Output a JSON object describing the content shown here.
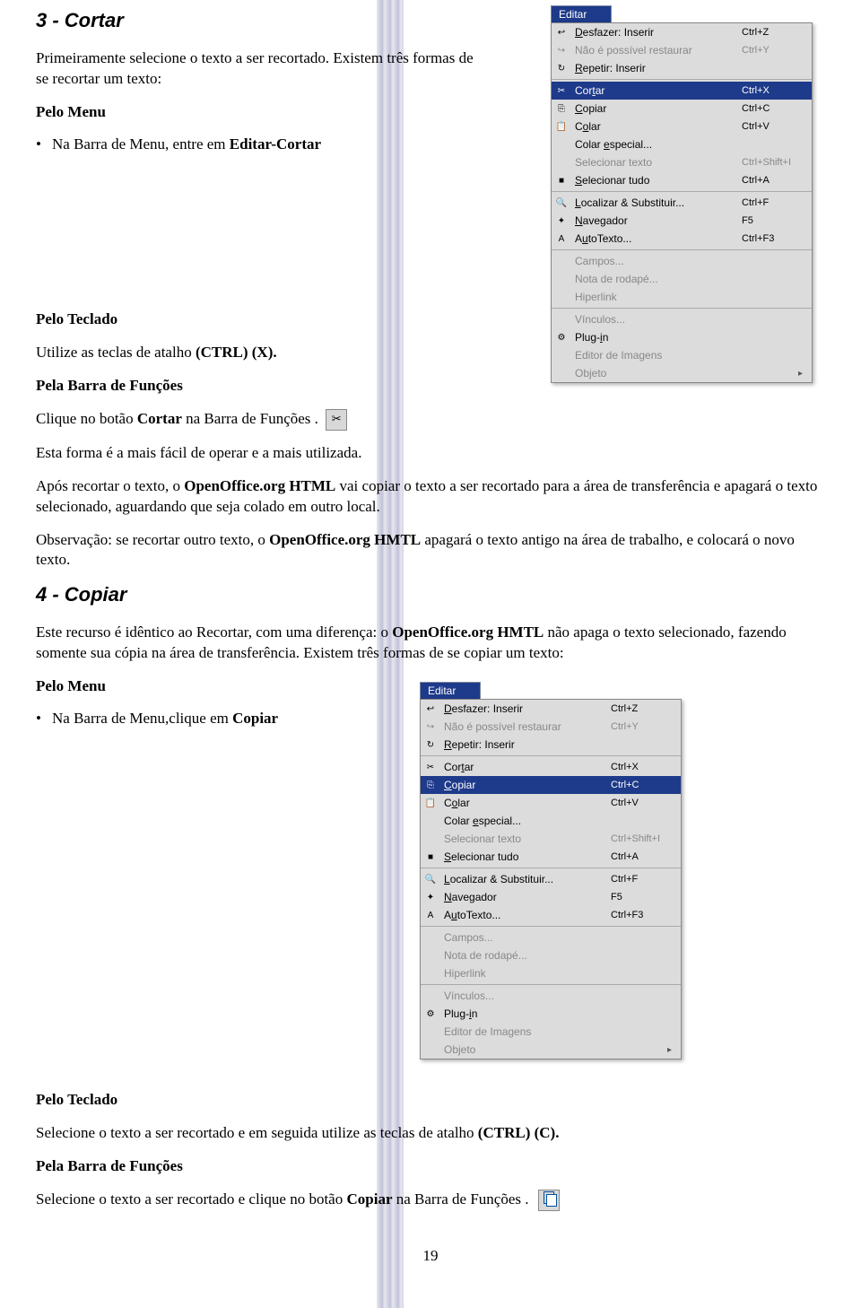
{
  "section3": {
    "title": "3 - Cortar",
    "p1": "Primeiramente selecione o texto a ser recortado. Existem três formas de se recortar um texto:",
    "pelo_menu": "Pelo Menu",
    "bullet1_pre": "Na Barra de Menu, entre em ",
    "bullet1_bold": "Editar-Cortar",
    "pelo_teclado": "Pelo Teclado",
    "p2_pre": "Utilize as teclas de atalho ",
    "p2_bold": "(CTRL) (X).",
    "pela_barra": "Pela Barra de Funções",
    "p3_pre": "Clique no botão ",
    "p3_bold": "Cortar",
    "p3_post": " na  Barra de Funções .",
    "p4": "Esta forma é a mais fácil de operar e a mais utilizada.",
    "p5_pre": "Após recortar o texto, o ",
    "p5_bold": "OpenOffice.org HTML",
    "p5_post": " vai copiar o texto a ser recortado para a área de transferência e apagará o texto selecionado, aguardando que seja colado em outro local.",
    "p6_pre": "Observação: se recortar outro texto, o ",
    "p6_bold": "OpenOffice.org HMTL",
    "p6_post": " apagará o texto antigo na área de trabalho, e colocará o novo texto."
  },
  "section4": {
    "title": "4 - Copiar",
    "p1_pre": "Este recurso é idêntico ao Recortar, com uma diferença: o ",
    "p1_bold": "OpenOffice.org HMTL",
    "p1_post": " não apaga o texto selecionado, fazendo somente sua cópia na área de transferência. Existem três formas de se copiar um texto:",
    "pelo_menu": "Pelo Menu",
    "bullet1_pre": "Na Barra de Menu,clique em ",
    "bullet1_bold": "Copiar",
    "pelo_teclado": "Pelo Teclado",
    "p2_pre": "Selecione o texto a ser recortado e em seguida utilize as teclas de atalho ",
    "p2_bold": "(CTRL) (C).",
    "pela_barra": "Pela Barra de Funções",
    "p3_pre": "Selecione o texto a ser recortado e clique no botão ",
    "p3_bold": "Copiar",
    "p3_post": " na  Barra de Funções ."
  },
  "menu": {
    "title": "Editar",
    "groups": [
      [
        {
          "icon": "↩",
          "label": "Desfazer: Inserir",
          "short": "Ctrl+Z",
          "disabled": false,
          "ul": "D"
        },
        {
          "icon": "↪",
          "label": "Não é possível restaurar",
          "short": "Ctrl+Y",
          "disabled": true
        },
        {
          "icon": "↻",
          "label": "Repetir: Inserir",
          "short": "",
          "disabled": false,
          "ul": "R"
        }
      ],
      [
        {
          "icon": "✂",
          "label": "Cortar",
          "short": "Ctrl+X",
          "selected": true,
          "ul": "t"
        },
        {
          "icon": "⎘",
          "label": "Copiar",
          "short": "Ctrl+C",
          "ul": "C"
        },
        {
          "icon": "📋",
          "label": "Colar",
          "short": "Ctrl+V",
          "ul": "o"
        },
        {
          "icon": "",
          "label": "Colar especial...",
          "short": "",
          "ul": "e"
        },
        {
          "icon": "",
          "label": "Selecionar texto",
          "short": "Ctrl+Shift+I",
          "disabled": true
        },
        {
          "icon": "■",
          "label": "Selecionar tudo",
          "short": "Ctrl+A",
          "ul": "S"
        }
      ],
      [
        {
          "icon": "🔍",
          "label": "Localizar & Substituir...",
          "short": "Ctrl+F",
          "ul": "L"
        },
        {
          "icon": "✦",
          "label": "Navegador",
          "short": "F5",
          "ul": "N"
        },
        {
          "icon": "A",
          "label": "AutoTexto...",
          "short": "Ctrl+F3",
          "ul": "u"
        }
      ],
      [
        {
          "icon": "",
          "label": "Campos...",
          "short": "",
          "disabled": true
        },
        {
          "icon": "",
          "label": "Nota de rodapé...",
          "short": "",
          "disabled": true
        },
        {
          "icon": "",
          "label": "Hiperlink",
          "short": "",
          "disabled": true
        }
      ],
      [
        {
          "icon": "",
          "label": "Vínculos...",
          "short": "",
          "disabled": true
        },
        {
          "icon": "⚙",
          "label": "Plug-in",
          "short": "",
          "ul": "i"
        },
        {
          "icon": "",
          "label": "Editor de Imagens",
          "short": "",
          "disabled": true
        },
        {
          "icon": "",
          "label": "Objeto",
          "short": "",
          "disabled": true,
          "arrow": true
        }
      ]
    ]
  },
  "menu2_selected_index": 1,
  "page_number": "19"
}
